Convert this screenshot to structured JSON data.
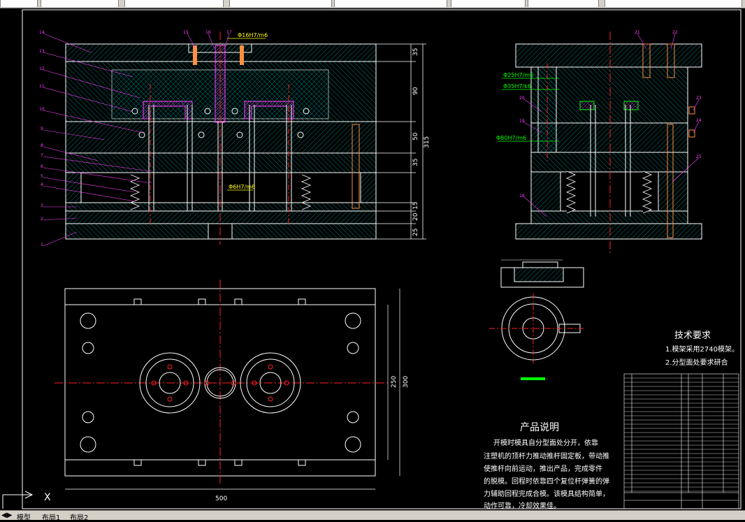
{
  "toolbar": {
    "segments": [
      "",
      "",
      "",
      "",
      "",
      "",
      "",
      ""
    ]
  },
  "layout_tabs": [
    "模型",
    "布局1",
    "布局2"
  ],
  "ucs": {
    "x_label": "X"
  },
  "section_view": {
    "fits": [
      "Φ16H7/m6",
      "Φ6H7/m6"
    ],
    "balloons": [
      "14",
      "13",
      "12",
      "11",
      "10",
      "9",
      "8",
      "7",
      "6",
      "5",
      "4",
      "3",
      "2",
      "1",
      "15",
      "16",
      "17"
    ],
    "dims": [
      "35",
      "90",
      "50",
      "35",
      "15",
      "20",
      "25",
      "315"
    ]
  },
  "side_view": {
    "fits": [
      "Φ25H7/m6",
      "Φ35H7/k6",
      "Φ80H7/m6"
    ],
    "balloons": [
      "21",
      "22",
      "20",
      "19",
      "23",
      "24",
      "25",
      "18"
    ]
  },
  "plan_view": {
    "dims": [
      "500",
      "250",
      "300"
    ]
  },
  "tech_req": {
    "title": "技术要求",
    "items": [
      "1.模架采用2740模架。",
      "2.分型面处要求研合"
    ]
  },
  "product_desc": {
    "title": "产品说明",
    "lines": [
      "开模时模具自分型面处分开，依靠",
      "注塑机的顶杆力推动推杆固定板，带动推",
      "使推杆向前运动，推出产品，完成零件",
      "的脱模。回程时依靠四个复位杆弹簧的弹",
      "力辅助回程完成合模。该模具结构简单，",
      "动作可靠，冷却效果佳。"
    ]
  },
  "colors": {
    "background": "#000000",
    "cyan": "#00c8c8",
    "white": "#ffffff",
    "red": "#ff2020",
    "magenta": "#ff40ff",
    "yellow": "#ffff00",
    "green": "#00ff00",
    "orange": "#ff9040"
  }
}
